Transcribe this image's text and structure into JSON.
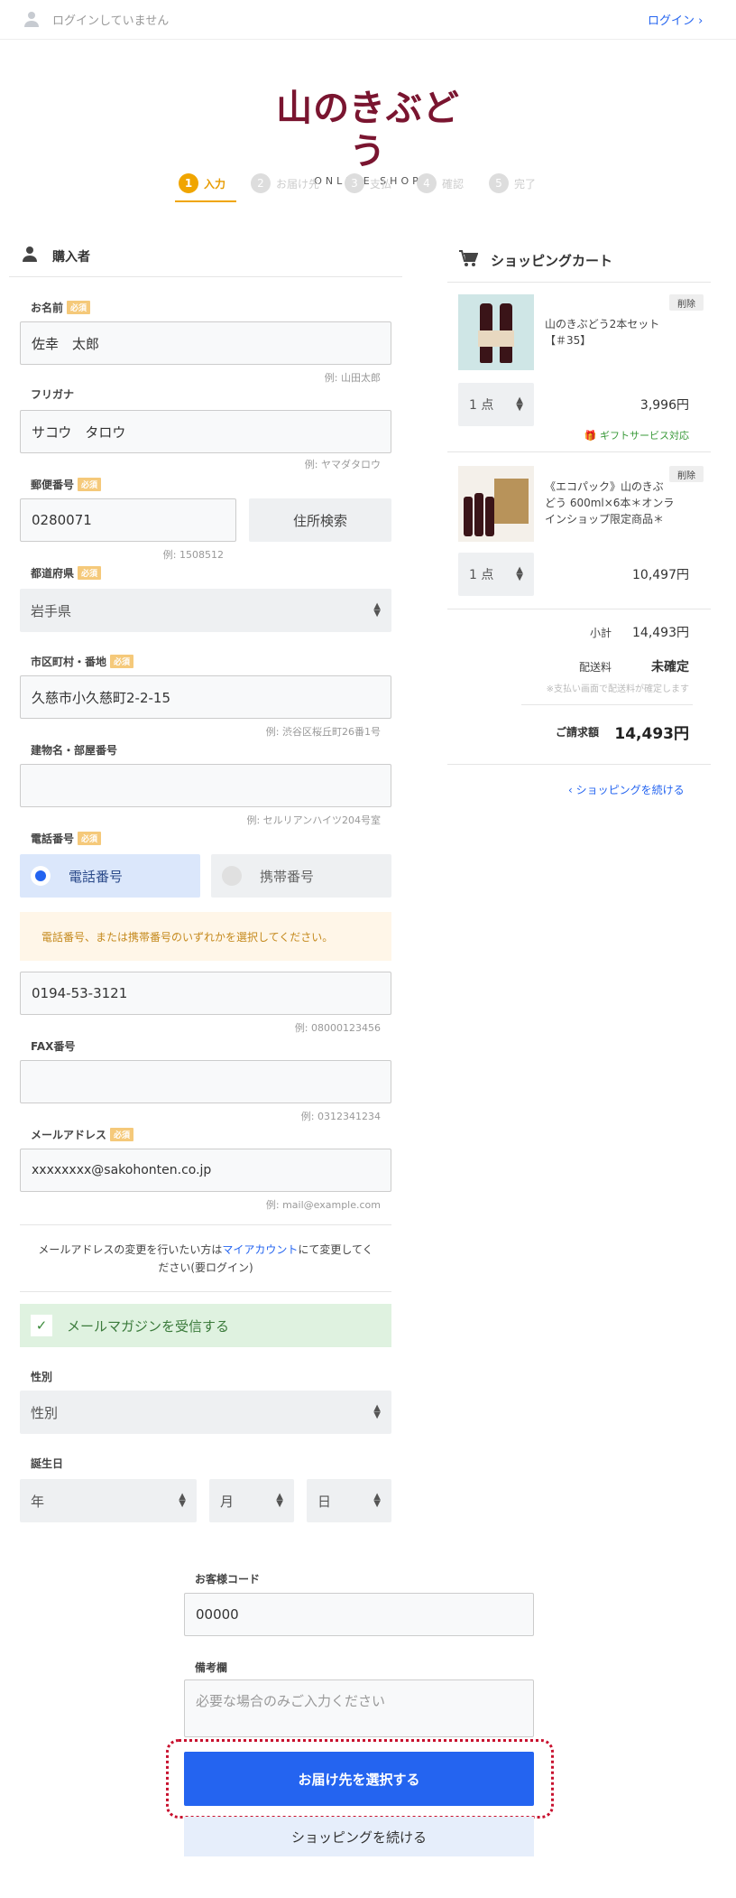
{
  "header": {
    "login_status": "ログインしていません",
    "login_link": "ログイン"
  },
  "logo": {
    "main": "山のきぶどう",
    "sub": "ONLINE SHOP"
  },
  "steps": [
    {
      "num": "1",
      "label": "入力"
    },
    {
      "num": "2",
      "label": "お届け先"
    },
    {
      "num": "3",
      "label": "支払"
    },
    {
      "num": "4",
      "label": "確認"
    },
    {
      "num": "5",
      "label": "完了"
    }
  ],
  "buyer": {
    "title": "購入者",
    "required": "必須",
    "name_label": "お名前",
    "name_value": "佐幸　太郎",
    "name_example": "例: 山田太郎",
    "kana_label": "フリガナ",
    "kana_value": "サコウ　タロウ",
    "kana_example": "例: ヤマダタロウ",
    "zip_label": "郵便番号",
    "zip_value": "0280071",
    "zip_example": "例: 1508512",
    "zip_search": "住所検索",
    "pref_label": "都道府県",
    "pref_value": "岩手県",
    "city_label": "市区町村・番地",
    "city_value": "久慈市小久慈町2-2-15",
    "city_example": "例: 渋谷区桜丘町26番1号",
    "bldg_label": "建物名・部屋番号",
    "bldg_value": "",
    "bldg_example": "例: セルリアンハイツ204号室",
    "phone_label": "電話番号",
    "phone_option1": "電話番号",
    "phone_option2": "携帯番号",
    "phone_note": "電話番号、または携帯番号のいずれかを選択してください。",
    "phone_value": "0194-53-3121",
    "phone_example": "例: 08000123456",
    "fax_label": "FAX番号",
    "fax_value": "",
    "fax_example": "例: 0312341234",
    "email_label": "メールアドレス",
    "email_value": "xxxxxxxx@sakohonten.co.jp",
    "email_example": "例: mail@example.com",
    "email_note_pre": "メールアドレスの変更を行いたい方は",
    "email_note_link": "マイアカウント",
    "email_note_post": "にて変更してく",
    "email_note_line2": "ださい(要ログイン)",
    "newsletter": "メールマガジンを受信する",
    "gender_label": "性別",
    "gender_value": "性別",
    "birthday_label": "誕生日",
    "year": "年",
    "month": "月",
    "day": "日"
  },
  "cart": {
    "title": "ショッピングカート",
    "delete": "削除",
    "items": [
      {
        "name_line1": "山のきぶどう2本セット",
        "name_line2": "【＃35】",
        "qty": "1 点",
        "price": "3,996円",
        "gift": "ギフトサービス対応"
      },
      {
        "name_line1": "《エコパック》山のきぶ",
        "name_line2": "どう 600ml×6本＊オンラ",
        "name_line3": "インショップ限定商品＊",
        "qty": "1 点",
        "price": "10,497円"
      }
    ],
    "subtotal_label": "小計",
    "subtotal": "14,493円",
    "shipping_label": "配送料",
    "shipping": "未確定",
    "shipping_note": "※支払い画面で配送料が確定します",
    "total_label": "ご請求額",
    "total": "14,493円",
    "continue": "ショッピングを続ける"
  },
  "bottom": {
    "customer_code_label": "お客様コード",
    "customer_code": "00000",
    "remarks_label": "備考欄",
    "remarks_placeholder": "必要な場合のみご入力ください",
    "submit": "お届け先を選択する",
    "continue": "ショッピングを続ける"
  }
}
